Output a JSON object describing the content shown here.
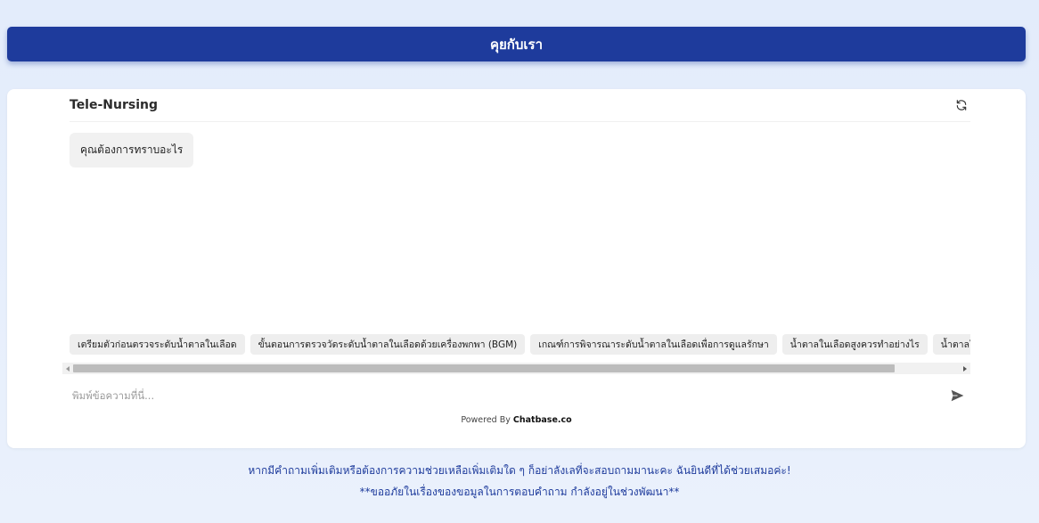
{
  "header": {
    "title": "คุยกับเรา"
  },
  "chat": {
    "title": "Tele-Nursing",
    "refresh_icon": "refresh-icon",
    "bot_message": "คุณต้องการทราบอะไร",
    "suggestions": [
      "เตรียมตัวก่อนตรวจระดับน้ำตาลในเลือด",
      "ขั้นตอนการตรวจวัดระดับน้ำตาลในเลือดด้วยเครื่องพกพา (BGM)",
      "เกณฑ์การพิจารณาระดับน้ำตาลในเลือดเพื่อการดูแลรักษา",
      "น้ำตาลในเลือดสูงควรทำอย่างไร",
      "น้ำตาลในเลือดต่ำควรทำอย่างไร"
    ],
    "input_placeholder": "พิมพ์ข้อความที่นี่...",
    "send_icon": "send-icon",
    "powered_prefix": "Powered By",
    "powered_brand": "Chatbase.co"
  },
  "footer": {
    "line1": "หากมีคำถามเพิ่มเติมหรือต้องการความช่วยเหลือเพิ่มเติมใด ๆ ก็อย่าลังเลที่จะสอบถามมานะคะ ฉันยินดีที่ได้ช่วยเสมอค่ะ!",
    "line2": "**ขออภัยในเรื่องของขอมูลในการตอบคำถาม กำลังอยู่ในช่วงพัฒนา**"
  },
  "colors": {
    "primary": "#1e3b9c",
    "background": "#e3ecfb",
    "chip": "#eeeeee"
  }
}
